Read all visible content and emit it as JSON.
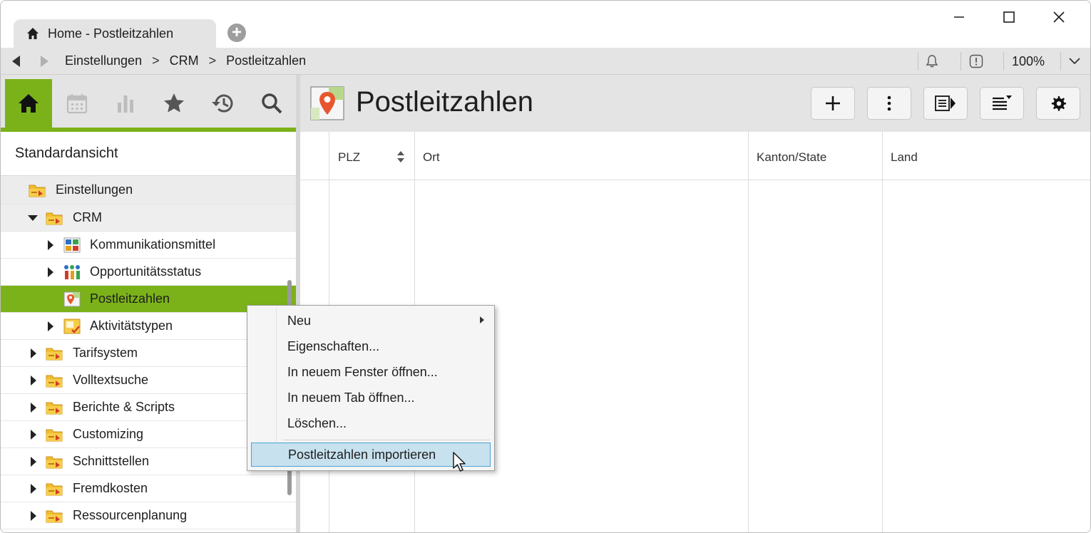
{
  "window": {
    "tab_title": "Home - Postleitzahlen",
    "controls": [
      "minimize",
      "maximize",
      "close"
    ]
  },
  "addressbar": {
    "breadcrumb": [
      "Einstellungen",
      "CRM",
      "Postleitzahlen"
    ],
    "separator": ">",
    "zoom": "100%"
  },
  "leftpanel": {
    "icon_tabs": [
      "home-icon",
      "calendar-icon",
      "chart-icon",
      "star-icon",
      "history-icon",
      "search-icon"
    ],
    "view_title": "Standardansicht",
    "tree": [
      {
        "label": "Einstellungen",
        "level": 0
      },
      {
        "label": "CRM",
        "level": 1,
        "expanded": true
      },
      {
        "label": "Kommunikationsmittel",
        "level": 2
      },
      {
        "label": "Opportunitätsstatus",
        "level": 2
      },
      {
        "label": "Postleitzahlen",
        "level": 2,
        "selected": true
      },
      {
        "label": "Aktivitätstypen",
        "level": 2
      },
      {
        "label": "Tarifsystem",
        "level": 1
      },
      {
        "label": "Volltextsuche",
        "level": 1
      },
      {
        "label": "Berichte & Scripts",
        "level": 1
      },
      {
        "label": "Customizing",
        "level": 1
      },
      {
        "label": "Schnittstellen",
        "level": 1
      },
      {
        "label": "Fremdkosten",
        "level": 1
      },
      {
        "label": "Ressourcenplanung",
        "level": 1
      }
    ]
  },
  "main": {
    "title": "Postleitzahlen",
    "toolbar": [
      "add-icon",
      "more-icon",
      "details-pane-icon",
      "list-view-icon",
      "settings-icon"
    ],
    "columns": [
      "PLZ",
      "Ort",
      "Kanton/State",
      "Land"
    ]
  },
  "context_menu": {
    "items": [
      {
        "label": "Neu",
        "submenu": true
      },
      {
        "label": "Eigenschaften..."
      },
      {
        "label": "In neuem Fenster öffnen..."
      },
      {
        "label": "In neuem Tab öffnen..."
      },
      {
        "label": "Löschen..."
      },
      {
        "label": "Postleitzahlen importieren",
        "highlighted": true
      }
    ]
  },
  "colors": {
    "accent": "#7bb21a",
    "chrome": "#e4e4e4",
    "menu_highlight": "#c7e1ee"
  }
}
